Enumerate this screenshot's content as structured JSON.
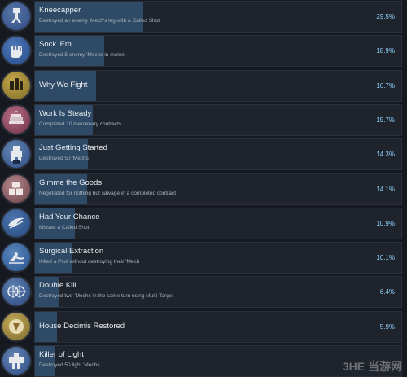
{
  "achievements": [
    {
      "title": "Kneecapper",
      "desc": "Destroyed an enemy 'Mech's leg with a Called Shot",
      "percent": "29.5%",
      "value": 29.5,
      "icon": "mech-leg-icon",
      "colors": [
        "#2c4a83",
        "#5a77a8"
      ]
    },
    {
      "title": "Sock 'Em",
      "desc": "Destroyed 5 enemy 'Mechs in melee",
      "percent": "18.9%",
      "value": 18.9,
      "icon": "fist-icon",
      "colors": [
        "#274b8a",
        "#4e78b6"
      ]
    },
    {
      "title": "Why We Fight",
      "desc": "",
      "percent": "16.7%",
      "value": 16.7,
      "icon": "raised-fists-icon",
      "colors": [
        "#7c6a28",
        "#c8a94a"
      ]
    },
    {
      "title": "Work Is Steady",
      "desc": "Completed 10 mercenary contracts",
      "percent": "15.7%",
      "value": 15.7,
      "icon": "contract-stack-icon",
      "colors": [
        "#6f3045",
        "#b56e84"
      ]
    },
    {
      "title": "Just Getting Started",
      "desc": "Destroyed 50 'Mechs",
      "percent": "14.3%",
      "value": 14.3,
      "icon": "mech-50-icon",
      "colors": [
        "#2d4d85",
        "#6584b4"
      ]
    },
    {
      "title": "Gimme the Goods",
      "desc": "Negotiated for nothing but salvage in a completed contract",
      "percent": "14.1%",
      "value": 14.1,
      "icon": "crates-icon",
      "colors": [
        "#6b4045",
        "#b58a8f"
      ]
    },
    {
      "title": "Had Your Chance",
      "desc": "Missed a Called Shot",
      "percent": "10.9%",
      "value": 10.9,
      "icon": "missed-shot-icon",
      "colors": [
        "#24477f",
        "#4f76ad"
      ]
    },
    {
      "title": "Surgical Extraction",
      "desc": "Killed a Pilot without destroying their 'Mech",
      "percent": "10.1%",
      "value": 10.1,
      "icon": "extraction-icon",
      "colors": [
        "#295590",
        "#5a86bd"
      ]
    },
    {
      "title": "Double Kill",
      "desc": "Destroyed two 'Mechs in the same turn using Multi-Target",
      "percent": "6.4%",
      "value": 6.4,
      "icon": "crosshairs-icon",
      "colors": [
        "#2b4b82",
        "#5f7fb0"
      ]
    },
    {
      "title": "House Decimis Restored",
      "desc": "",
      "percent": "5.9%",
      "value": 5.9,
      "icon": "house-crest-icon",
      "colors": [
        "#7b6a2d",
        "#c5ab5a"
      ]
    },
    {
      "title": "Killer of Light",
      "desc": "Destroyed 50 light 'Mechs",
      "percent": "",
      "value": 5.2,
      "icon": "light-mech-icon",
      "colors": [
        "#2c4c84",
        "#6584b4"
      ]
    }
  ],
  "watermark": "3HE 当游网"
}
